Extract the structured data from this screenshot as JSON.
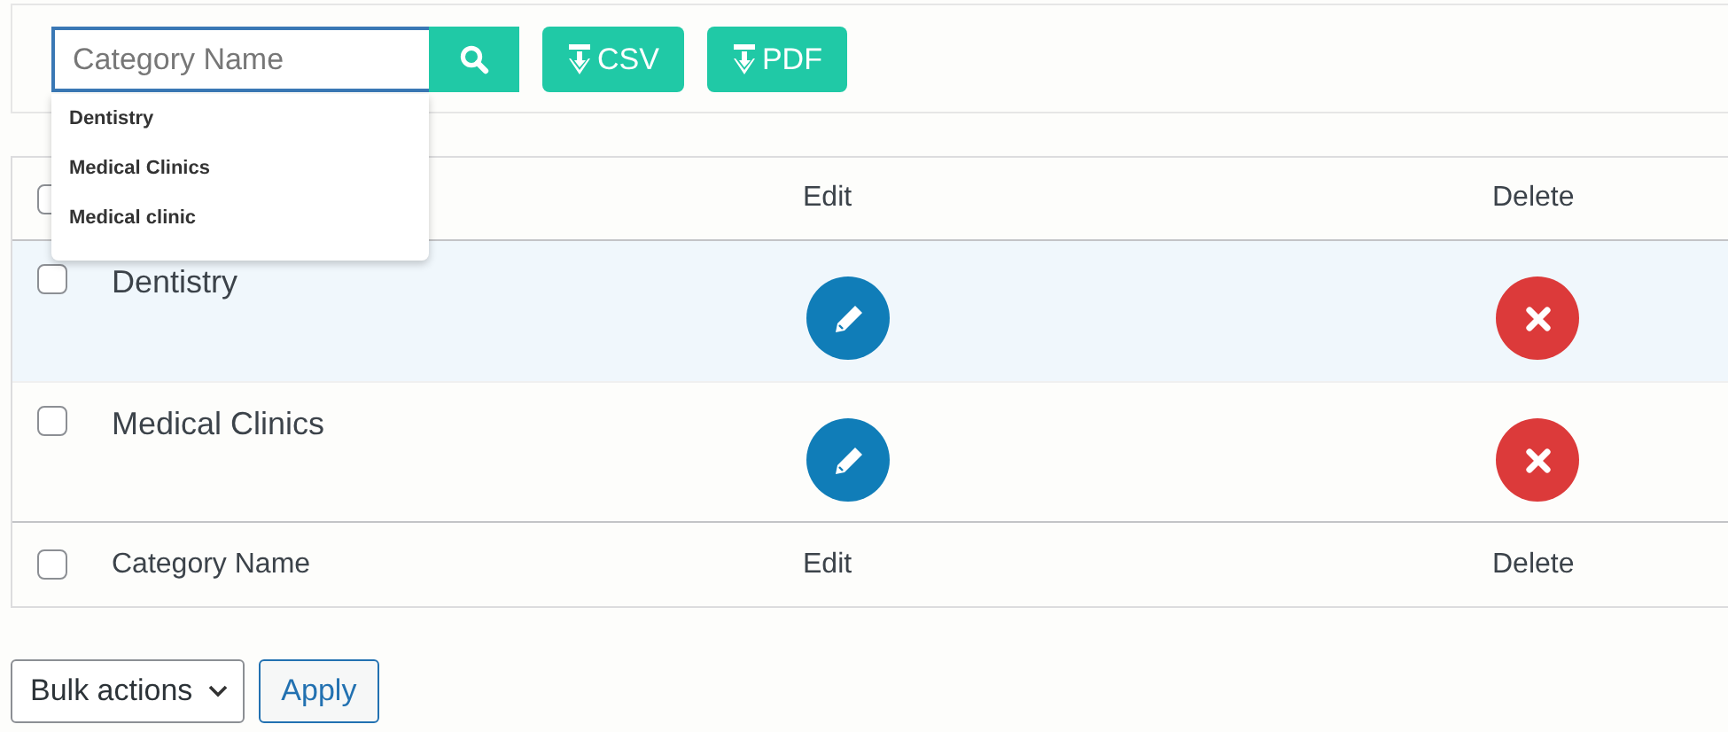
{
  "search": {
    "placeholder": "Category Name"
  },
  "suggestions": [
    "Dentistry",
    "Medical Clinics",
    "Medical clinic"
  ],
  "export_buttons": [
    {
      "label": "CSV"
    },
    {
      "label": "PDF"
    }
  ],
  "table": {
    "header": {
      "checked": false,
      "edit": "Edit",
      "delete": "Delete"
    },
    "rows": [
      {
        "name": "Dentistry",
        "checked": false,
        "highlighted": true
      },
      {
        "name": "Medical Clinics",
        "checked": false,
        "highlighted": false
      }
    ],
    "footer": {
      "checked": false,
      "name": "Category Name",
      "edit": "Edit",
      "delete": "Delete"
    }
  },
  "bulk_actions": {
    "label": "Bulk actions"
  },
  "apply_button": {
    "label": "Apply"
  }
}
